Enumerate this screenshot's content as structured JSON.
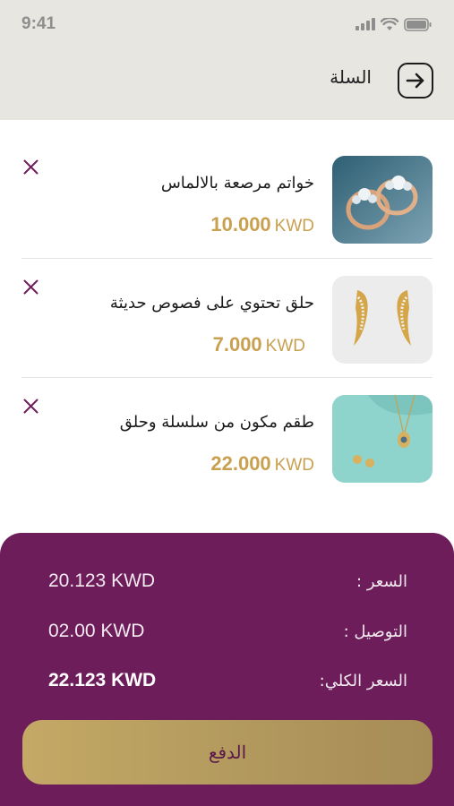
{
  "status_bar": {
    "time": "9:41"
  },
  "header": {
    "title": "السلة"
  },
  "cart": {
    "items": [
      {
        "name": "خواتم مرصعة بالالماس",
        "amount": "10.000",
        "currency": "KWD"
      },
      {
        "name": "حلق تحتوي على فصوص حديثة",
        "amount": "7.000",
        "currency": "KWD"
      },
      {
        "name": "طقم مكون من سلسلة وحلق",
        "amount": "22.000",
        "currency": "KWD"
      }
    ]
  },
  "summary": {
    "price_label": "السعر :",
    "price_value": "20.123 KWD",
    "delivery_label": "التوصيل :",
    "delivery_value": "02.00 KWD",
    "total_label": "السعر الكلي:",
    "total_value": "22.123 KWD"
  },
  "pay_button": {
    "label": "الدفع"
  },
  "colors": {
    "accent": "#6e1d5b",
    "gold": "#c9a04f",
    "header_bg": "#e8e6e1"
  }
}
